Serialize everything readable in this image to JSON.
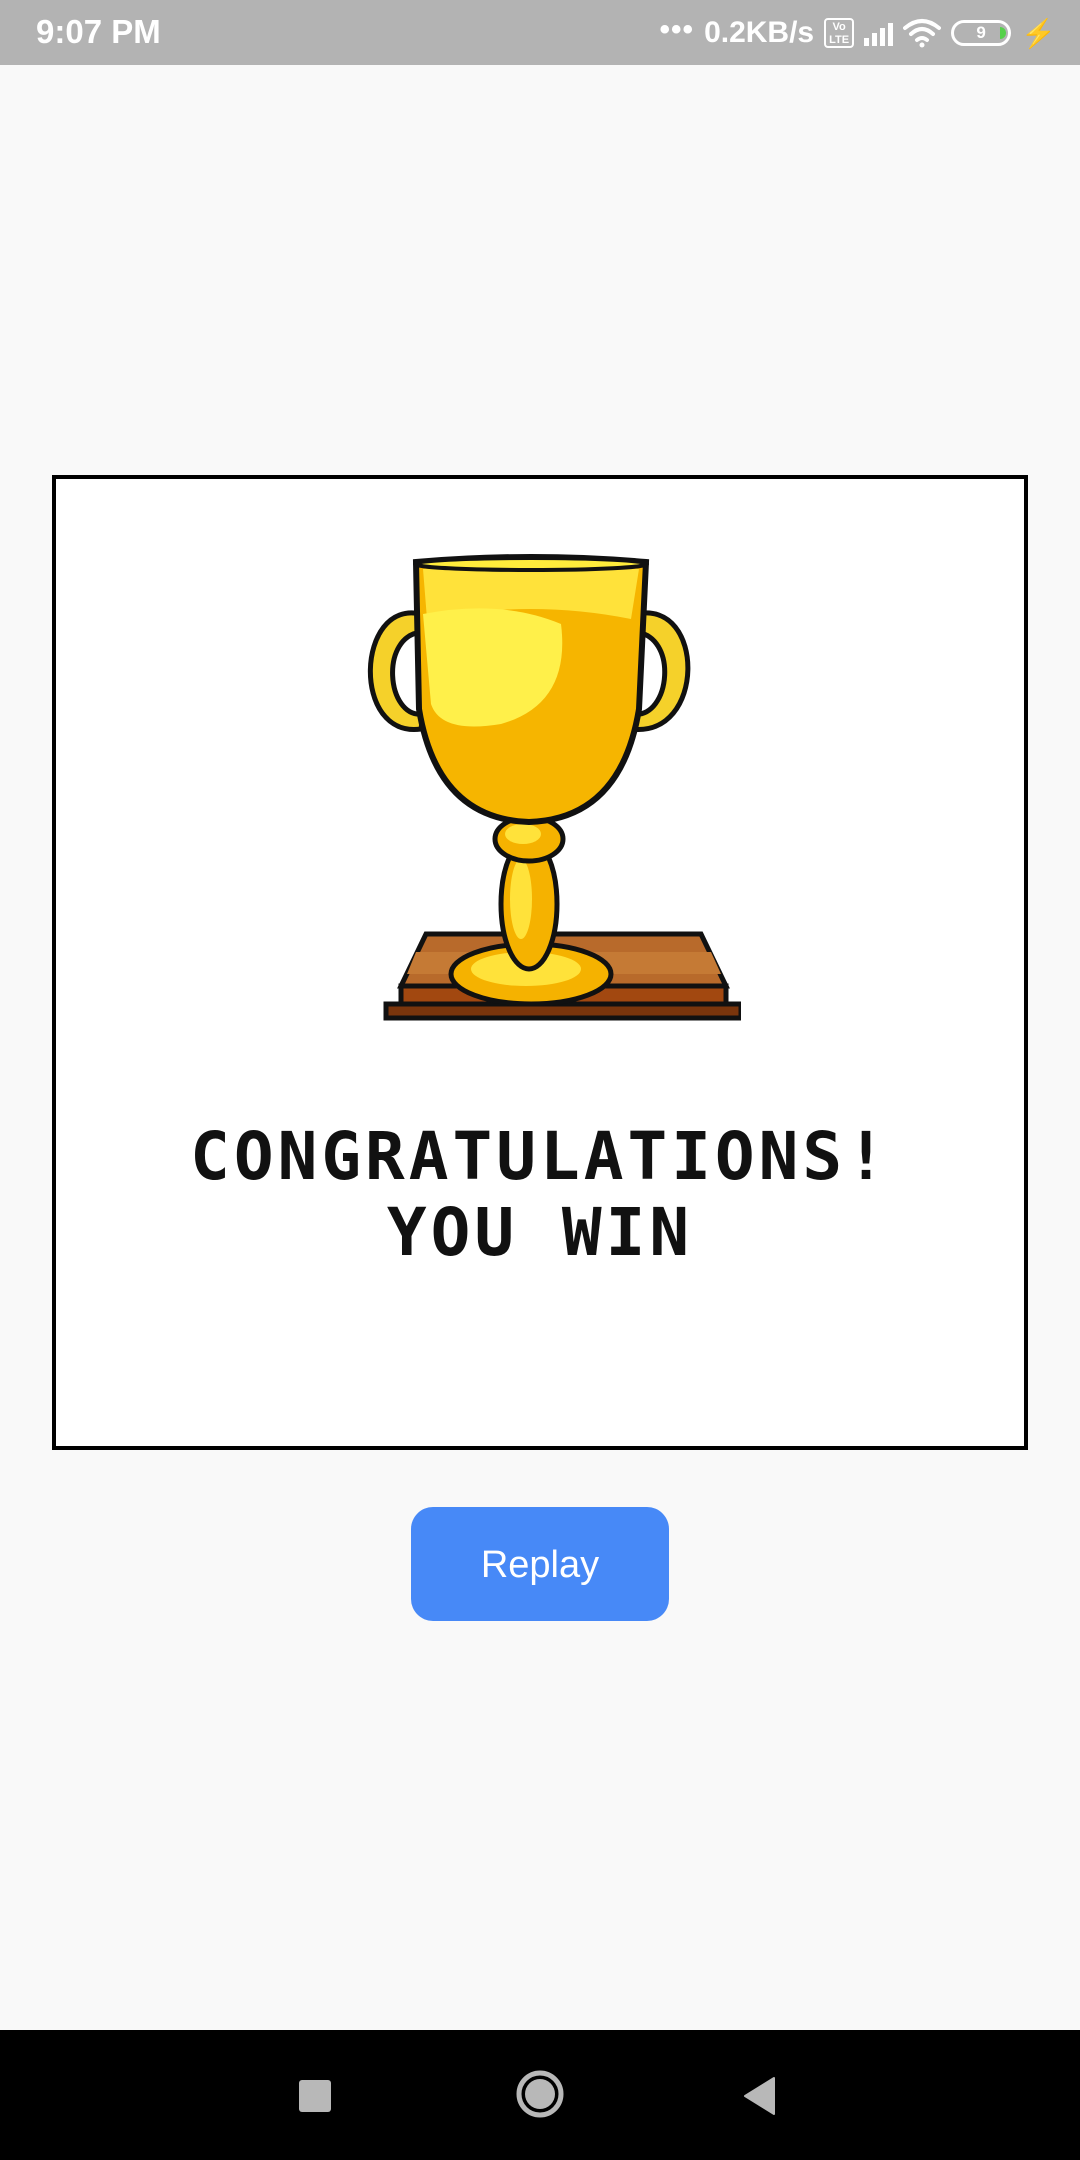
{
  "status_bar": {
    "time": "9:07 PM",
    "dots": "•••",
    "network_speed": "0.2KB/s",
    "volte_label": "Vo\nLTE",
    "battery_level": "9",
    "icons": [
      "volte-icon",
      "signal-icon",
      "wifi-icon",
      "battery-icon",
      "charging-icon"
    ]
  },
  "card": {
    "image": "trophy-icon",
    "line1": "CONGRATULATIONS!",
    "line2": "YOU WIN"
  },
  "replay_button": {
    "label": "Replay",
    "color": "#4789f7"
  },
  "nav_bar": {
    "icons": [
      "recents-icon",
      "home-icon",
      "back-icon"
    ]
  }
}
